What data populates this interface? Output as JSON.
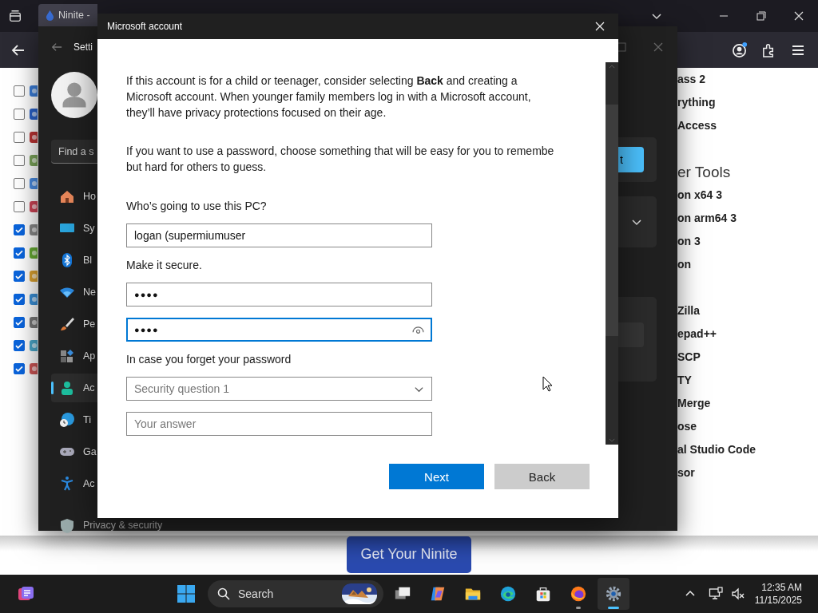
{
  "browser": {
    "tab_title": "Ninite -",
    "checklist": [
      {
        "checked": false
      },
      {
        "checked": false
      },
      {
        "checked": false
      },
      {
        "checked": false
      },
      {
        "checked": false
      },
      {
        "checked": false
      },
      {
        "checked": true
      },
      {
        "checked": true
      },
      {
        "checked": true
      },
      {
        "checked": true
      },
      {
        "checked": true
      },
      {
        "checked": true
      },
      {
        "checked": true
      }
    ],
    "top_apps": [
      "ass 2",
      "rything",
      "Access"
    ],
    "section_heading": "er Tools",
    "mid_apps": [
      "on x64 3",
      "on arm64 3",
      "on 3",
      "on"
    ],
    "bottom_apps": [
      "Zilla",
      "epad++",
      "SCP",
      "TY",
      "Merge",
      "ose",
      "al Studio Code",
      "sor"
    ],
    "get_button": "Get Your Ninite"
  },
  "settings": {
    "title": "Setti",
    "search_placeholder": "Find a s",
    "nav": [
      {
        "label": "Ho",
        "kind": "home",
        "selected": false
      },
      {
        "label": "Sy",
        "kind": "system",
        "selected": false
      },
      {
        "label": "Bl",
        "kind": "bluetooth",
        "selected": false
      },
      {
        "label": "Ne",
        "kind": "network",
        "selected": false
      },
      {
        "label": "Pe",
        "kind": "personalization",
        "selected": false
      },
      {
        "label": "Ap",
        "kind": "apps",
        "selected": false
      },
      {
        "label": "Ac",
        "kind": "accounts",
        "selected": true
      },
      {
        "label": "Ti",
        "kind": "time",
        "selected": false
      },
      {
        "label": "Ga",
        "kind": "gaming",
        "selected": false
      },
      {
        "label": "Ac",
        "kind": "accessibility",
        "selected": false
      },
      {
        "label": "Privacy & security",
        "kind": "privacy",
        "selected": false
      }
    ],
    "panel_button": "t"
  },
  "dialog": {
    "title": "Microsoft account",
    "paragraphs": [
      [
        "If this account is for a child or teenager, consider selecting **Back** and creating a",
        "Microsoft account. When younger family members log in with a Microsoft account,",
        "they’ll have privacy protections focused on their age."
      ],
      [
        "If you want to use a password, choose something that will be easy for you to remembe",
        "but hard for others to guess."
      ]
    ],
    "fields": [
      {
        "label": "Who’s going to use this PC?",
        "kind": "text",
        "value": "logan (supermiumuser",
        "focused": false
      },
      {
        "label": "Make it secure.",
        "kind": "password",
        "value": "●●●●",
        "focused": false
      },
      {
        "kind": "password",
        "value": "●●●●",
        "focused": true
      },
      {
        "label": "In case you forget your password",
        "kind": "select",
        "placeholder": "Security question 1",
        "focused": false
      },
      {
        "kind": "text",
        "placeholder": "Your answer",
        "focused": false
      }
    ],
    "buttons": [
      {
        "label": "Next",
        "kind": "primary"
      },
      {
        "label": "Back",
        "kind": "secondary"
      }
    ]
  },
  "taskbar": {
    "search": "Search",
    "apps": [
      {
        "kind": "taskview",
        "running": false,
        "selected": false
      },
      {
        "kind": "copilot",
        "running": false,
        "selected": false
      },
      {
        "kind": "explorer",
        "running": false,
        "selected": false
      },
      {
        "kind": "edge",
        "running": false,
        "selected": false
      },
      {
        "kind": "store",
        "running": false,
        "selected": false
      },
      {
        "kind": "firefox",
        "running": true,
        "selected": false
      },
      {
        "kind": "settings",
        "running": true,
        "selected": true
      }
    ],
    "time": "12:35 AM",
    "date": "11/15/2025"
  }
}
